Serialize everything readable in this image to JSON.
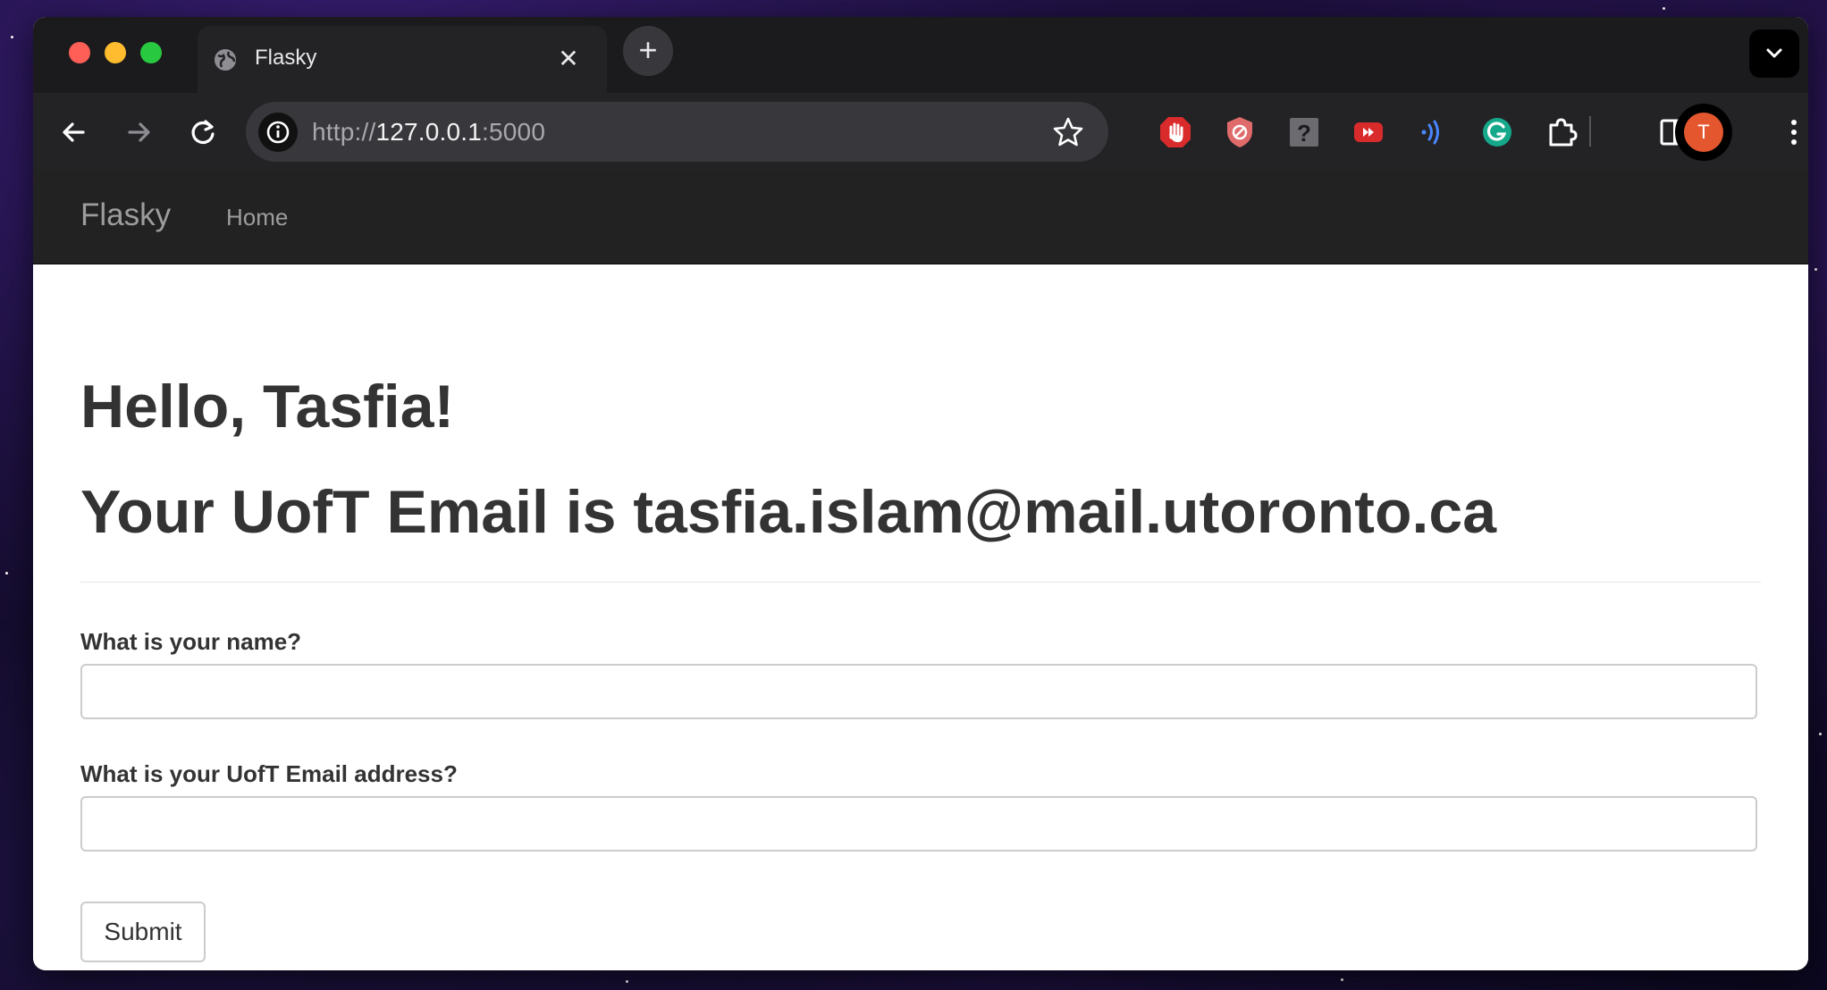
{
  "browser": {
    "tab": {
      "title": "Flasky",
      "icon": "globe-icon"
    },
    "new_tab_label": "+",
    "address": {
      "scheme": "http://",
      "host": "127.0.0.1",
      "port": ":5000"
    },
    "profile_initial": "T"
  },
  "navbar": {
    "brand": "Flasky",
    "links": [
      "Home"
    ]
  },
  "main": {
    "greeting": "Hello, Tasfia!",
    "email_heading": "Your UofT Email is tasfia.islam@mail.utoronto.ca"
  },
  "form": {
    "name_label": "What is your name?",
    "name_value": "",
    "email_label": "What is your UofT Email address?",
    "email_value": "",
    "submit_label": "Submit"
  },
  "colors": {
    "navbar_bg": "#222222",
    "nav_text": "#9d9d9d",
    "heading_text": "#333333",
    "avatar_bg": "#e4572e"
  }
}
